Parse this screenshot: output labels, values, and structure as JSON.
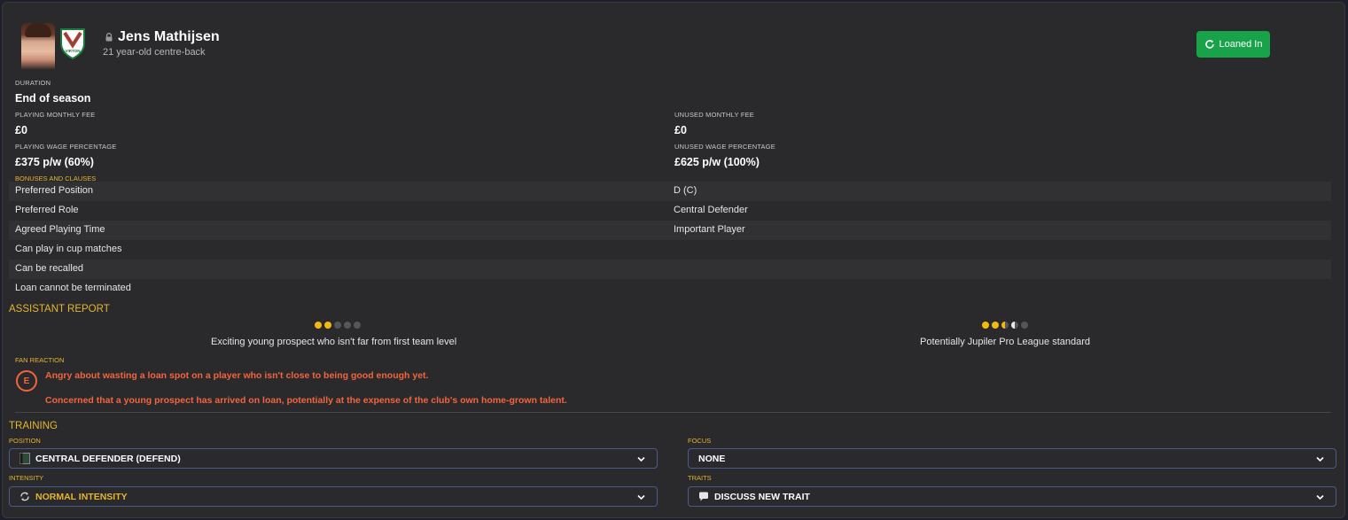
{
  "player": {
    "name": "Jens Mathijsen",
    "subtitle": "21 year-old centre-back",
    "status_button": "Loaned In",
    "club_crest_text": "VIRTON"
  },
  "contract": {
    "duration_label": "DURATION",
    "duration_value": "End of season",
    "playing_fee_label": "PLAYING MONTHLY FEE",
    "playing_fee_value": "£0",
    "unused_fee_label": "UNUSED MONTHLY FEE",
    "unused_fee_value": "£0",
    "playing_wage_label": "PLAYING WAGE PERCENTAGE",
    "playing_wage_value": "£375 p/w (60%)",
    "unused_wage_label": "UNUSED WAGE PERCENTAGE",
    "unused_wage_value": "£625 p/w (100%)"
  },
  "clauses": {
    "title": "BONUSES AND CLAUSES",
    "rows": [
      {
        "label": "Preferred Position",
        "value": "D (C)"
      },
      {
        "label": "Preferred Role",
        "value": "Central Defender"
      },
      {
        "label": "Agreed Playing Time",
        "value": "Important Player"
      },
      {
        "label": "Can play in cup matches",
        "value": ""
      },
      {
        "label": "Can be recalled",
        "value": ""
      },
      {
        "label": "Loan cannot be terminated",
        "value": ""
      }
    ]
  },
  "assistant_report": {
    "title": "ASSISTANT REPORT",
    "current_ability_stars": 2,
    "current_text": "Exciting young prospect who isn't far from first team level",
    "potential_ability_stars": 3.5,
    "potential_text": "Potentially Jupiler Pro League standard"
  },
  "fan_reaction": {
    "title": "FAN REACTION",
    "grade": "E",
    "line1": "Angry about wasting a loan spot on a player who isn't close to being good enough yet.",
    "line2": "Concerned that a young prospect has arrived on loan, potentially at the expense of the club's own home-grown talent."
  },
  "training": {
    "title": "TRAINING",
    "position_label": "POSITION",
    "position_value": "CENTRAL DEFENDER (DEFEND)",
    "focus_label": "FOCUS",
    "focus_value": "NONE",
    "intensity_label": "INTENSITY",
    "intensity_value": "NORMAL INTENSITY",
    "traits_label": "TRAITS",
    "traits_value": "DISCUSS NEW TRAIT"
  },
  "colors": {
    "accent_yellow": "#e5b530",
    "accent_green": "#18a34a",
    "fan_red": "#f4643c"
  }
}
